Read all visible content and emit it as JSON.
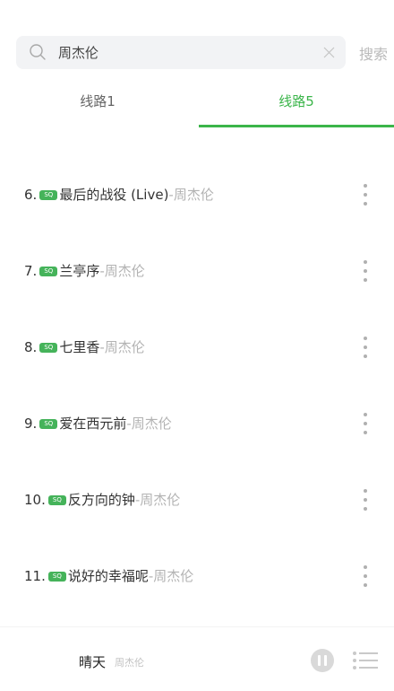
{
  "search": {
    "value": "周杰伦",
    "button_label": "搜索"
  },
  "tabs": [
    {
      "label": "线路1",
      "active": false
    },
    {
      "label": "线路5",
      "active": true
    }
  ],
  "accent_color": "#3bb54a",
  "songs": [
    {
      "number": "6.",
      "badge": "SQ",
      "title": "最后的战役 (Live)",
      "artist": "-周杰伦"
    },
    {
      "number": "7.",
      "badge": "SQ",
      "title": "兰亭序",
      "artist": "-周杰伦"
    },
    {
      "number": "8.",
      "badge": "SQ",
      "title": "七里香",
      "artist": "-周杰伦"
    },
    {
      "number": "9.",
      "badge": "SQ",
      "title": "爱在西元前",
      "artist": "-周杰伦"
    },
    {
      "number": "10.",
      "badge": "SQ",
      "title": "反方向的钟",
      "artist": "-周杰伦"
    },
    {
      "number": "11.",
      "badge": "SQ",
      "title": "说好的幸福呢",
      "artist": "-周杰伦"
    }
  ],
  "player": {
    "title": "晴天",
    "artist": "周杰伦",
    "state": "playing"
  }
}
